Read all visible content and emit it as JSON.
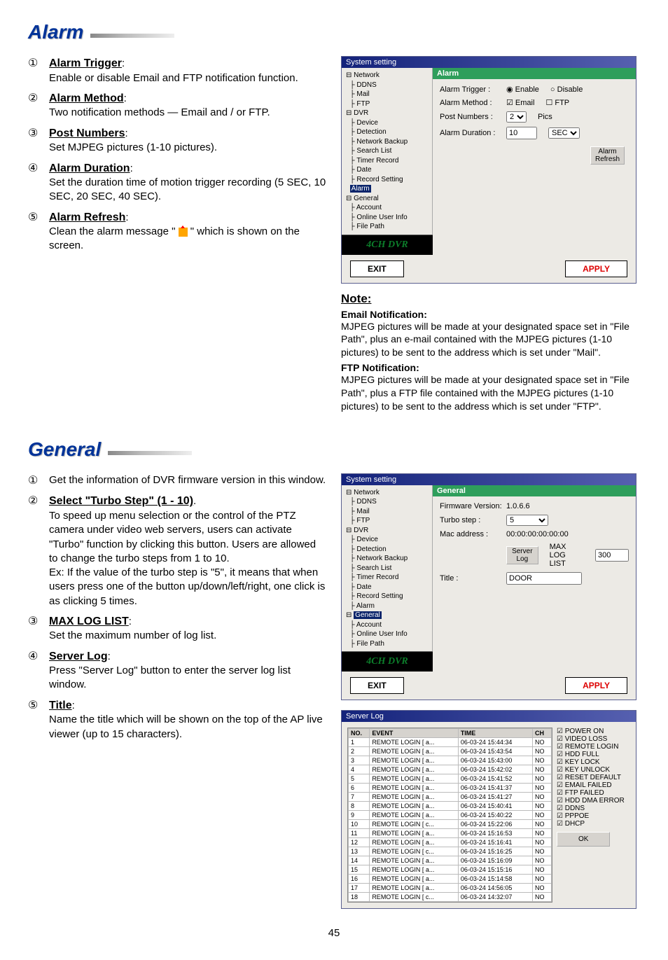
{
  "page_number": "45",
  "sections": {
    "alarm": {
      "heading": "Alarm",
      "items": [
        {
          "num": "①",
          "title": "Alarm Trigger",
          "body": "Enable or disable Email and FTP notification function."
        },
        {
          "num": "②",
          "title": "Alarm Method",
          "body": "Two notification methods — Email and / or FTP."
        },
        {
          "num": "③",
          "title": "Post Numbers",
          "body": "Set MJPEG pictures (1-10 pictures)."
        },
        {
          "num": "④",
          "title": "Alarm Duration",
          "body": "Set the duration time of motion trigger recording (5 SEC, 10 SEC, 20 SEC, 40 SEC)."
        },
        {
          "num": "⑤",
          "title": "Alarm Refresh",
          "body": "Clean the alarm message \" \" which is shown on the screen."
        }
      ],
      "alarm_icon_name": "alarm-icon"
    },
    "general": {
      "heading": "General",
      "items": [
        {
          "num": "①",
          "title": "",
          "body": "Get the information of DVR firmware version in this window."
        },
        {
          "num": "②",
          "title": "Select \"Turbo Step\" (1 - 10)",
          "body": "To speed up menu selection or the control of the PTZ camera under video web servers, users can activate \"Turbo\" function by clicking this button. Users are allowed to change the turbo steps from 1 to 10.\nEx: If the value of the turbo step is \"5\", it means that when users press one of the button up/down/left/right, one click is as clicking 5 times."
        },
        {
          "num": "③",
          "title": "MAX LOG LIST",
          "body": "Set the maximum number of log list."
        },
        {
          "num": "④",
          "title": "Server Log",
          "body": "Press \"Server Log\" button to enter the server log list window."
        },
        {
          "num": "⑤",
          "title": "Title",
          "body": "Name the title which will be shown on the top of the AP live viewer (up to 15 characters)."
        }
      ]
    }
  },
  "note": {
    "heading": "Note:",
    "email_sub": "Email Notification:",
    "email_body": "MJPEG  pictures will be made at your designated space set in \"File Path\", plus an e-mail contained with the MJPEG pictures (1-10 pictures) to be sent to the address which is set under \"Mail\".",
    "ftp_sub": "FTP Notification:",
    "ftp_body": "MJPEG  pictures will be made at your designated space set in \"File Path\", plus a FTP file contained with the MJPEG pictures (1-10 pictures) to be sent to the address which is set under \"FTP\"."
  },
  "dialog_alarm": {
    "window_title": "System setting",
    "brand": "4CH DVR",
    "pane_title": "Alarm",
    "tree": {
      "nodes": [
        "Network",
        " DDNS",
        " Mail",
        " FTP",
        "DVR",
        " Device",
        " Detection",
        " Network Backup",
        " Search List",
        " Timer Record",
        " Date",
        " Record Setting",
        " Alarm",
        "General",
        " Account",
        " Online User Info",
        " File Path"
      ],
      "selected": "Alarm"
    },
    "rows": {
      "trigger_label": "Alarm Trigger :",
      "trigger_opts": {
        "enable": "Enable",
        "disable": "Disable"
      },
      "method_label": "Alarm Method :",
      "method_opts": {
        "email": "Email",
        "ftp": "FTP"
      },
      "post_label": "Post Numbers :",
      "post_value": "2",
      "post_suffix": "Pics",
      "duration_label": "Alarm Duration :",
      "duration_value": "10",
      "duration_unit": "SEC"
    },
    "refresh_btn": "Alarm\nRefresh",
    "exit": "EXIT",
    "apply": "APPLY"
  },
  "dialog_general": {
    "window_title": "System setting",
    "brand": "4CH DVR",
    "pane_title": "General",
    "tree": {
      "nodes": [
        "Network",
        " DDNS",
        " Mail",
        " FTP",
        "DVR",
        " Device",
        " Detection",
        " Network Backup",
        " Search List",
        " Timer Record",
        " Date",
        " Record Setting",
        " Alarm",
        "General",
        " Account",
        " Online User Info",
        " File Path"
      ],
      "selected": "General"
    },
    "rows": {
      "fw_label": "Firmware Version:",
      "fw_value": "1.0.6.6",
      "turbo_label": "Turbo step :",
      "turbo_value": "5",
      "mac_label": "Mac address :",
      "mac_value": "00:00:00:00:00:00",
      "serverlog_btn": "Server Log",
      "maxlog_label": "MAX LOG LIST",
      "maxlog_value": "300",
      "title_label": "Title :",
      "title_value": "DOOR"
    },
    "exit": "EXIT",
    "apply": "APPLY"
  },
  "server_log": {
    "window_title": "Server Log",
    "headers": {
      "no": "NO.",
      "event": "EVENT",
      "time": "TIME",
      "ch": "CH"
    },
    "rows": [
      {
        "no": "1",
        "event": "REMOTE LOGIN [ a...",
        "time": "06-03-24 15:44:34",
        "ch": "NO"
      },
      {
        "no": "2",
        "event": "REMOTE LOGIN [ a...",
        "time": "06-03-24 15:43:54",
        "ch": "NO"
      },
      {
        "no": "3",
        "event": "REMOTE LOGIN [ a...",
        "time": "06-03-24 15:43:00",
        "ch": "NO"
      },
      {
        "no": "4",
        "event": "REMOTE LOGIN [ a...",
        "time": "06-03-24 15:42:02",
        "ch": "NO"
      },
      {
        "no": "5",
        "event": "REMOTE LOGIN [ a...",
        "time": "06-03-24 15:41:52",
        "ch": "NO"
      },
      {
        "no": "6",
        "event": "REMOTE LOGIN [ a...",
        "time": "06-03-24 15:41:37",
        "ch": "NO"
      },
      {
        "no": "7",
        "event": "REMOTE LOGIN [ a...",
        "time": "06-03-24 15:41:27",
        "ch": "NO"
      },
      {
        "no": "8",
        "event": "REMOTE LOGIN [ a...",
        "time": "06-03-24 15:40:41",
        "ch": "NO"
      },
      {
        "no": "9",
        "event": "REMOTE LOGIN [ a...",
        "time": "06-03-24 15:40:22",
        "ch": "NO"
      },
      {
        "no": "10",
        "event": "REMOTE LOGIN [ c...",
        "time": "06-03-24 15:22:06",
        "ch": "NO"
      },
      {
        "no": "11",
        "event": "REMOTE LOGIN [ a...",
        "time": "06-03-24 15:16:53",
        "ch": "NO"
      },
      {
        "no": "12",
        "event": "REMOTE LOGIN [ a...",
        "time": "06-03-24 15:16:41",
        "ch": "NO"
      },
      {
        "no": "13",
        "event": "REMOTE LOGIN [ c...",
        "time": "06-03-24 15:16:25",
        "ch": "NO"
      },
      {
        "no": "14",
        "event": "REMOTE LOGIN [ a...",
        "time": "06-03-24 15:16:09",
        "ch": "NO"
      },
      {
        "no": "15",
        "event": "REMOTE LOGIN [ a...",
        "time": "06-03-24 15:15:16",
        "ch": "NO"
      },
      {
        "no": "16",
        "event": "REMOTE LOGIN [ a...",
        "time": "06-03-24 15:14:58",
        "ch": "NO"
      },
      {
        "no": "17",
        "event": "REMOTE LOGIN [ a...",
        "time": "06-03-24 14:56:05",
        "ch": "NO"
      },
      {
        "no": "18",
        "event": "REMOTE LOGIN [ c...",
        "time": "06-03-24 14:32:07",
        "ch": "NO"
      }
    ],
    "filters": [
      "POWER ON",
      "VIDEO LOSS",
      "REMOTE LOGIN",
      "HDD FULL",
      "KEY LOCK",
      "KEY UNLOCK",
      "RESET DEFAULT",
      "EMAIL FAILED",
      "FTP FAILED",
      "HDD DMA ERROR",
      "DDNS",
      "PPPOE",
      "DHCP"
    ],
    "ok": "OK"
  }
}
